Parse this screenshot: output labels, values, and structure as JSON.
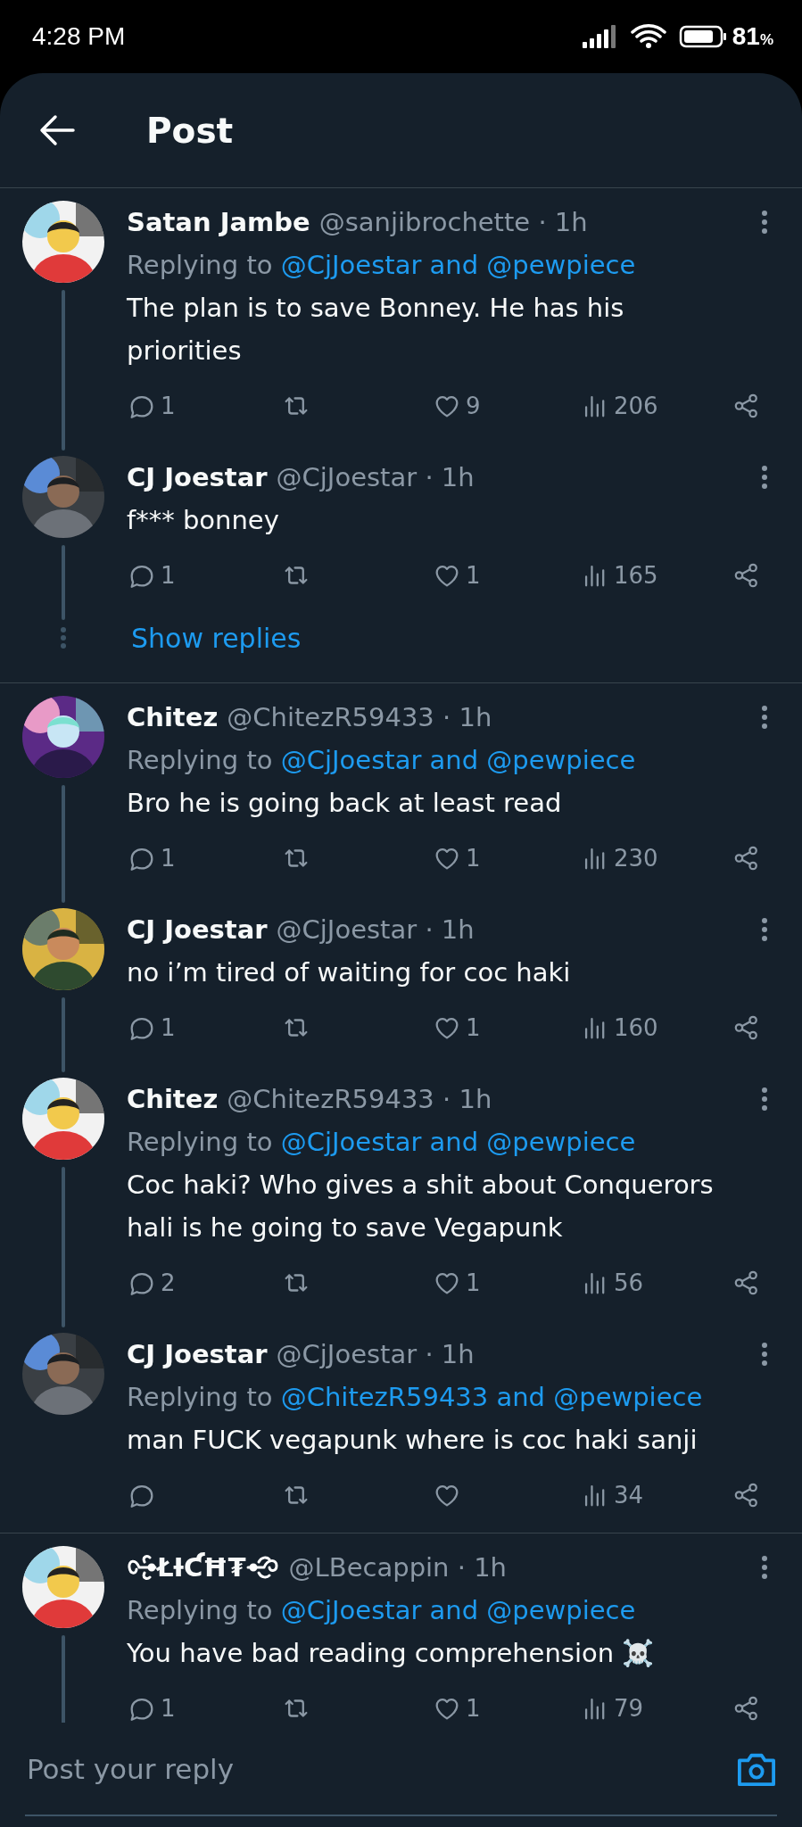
{
  "status_bar": {
    "time": "4:28 PM",
    "battery": "81",
    "battery_unit": "%"
  },
  "header": {
    "title": "Post"
  },
  "threads": [
    {
      "tweets": [
        {
          "name": "Satan Jambe",
          "handle": "@sanjibrochette",
          "time": "· 1h",
          "replying_prefix": "Replying to",
          "replying_to": "@CjJoestar and @pewpiece",
          "text": [
            "The plan is to save Bonney. He has his",
            "priorities"
          ],
          "replies": "1",
          "likes": "9",
          "views": "206",
          "connected": true
        },
        {
          "name": "CJ Joestar",
          "handle": "@CjJoestar",
          "time": "· 1h",
          "text": [
            "f*** bonney"
          ],
          "replies": "1",
          "likes": "1",
          "views": "165",
          "connected": true
        }
      ],
      "show_replies": "Show replies"
    },
    {
      "tweets": [
        {
          "name": "Chitez",
          "handle": "@ChitezR59433",
          "time": "· 1h",
          "replying_prefix": "Replying to",
          "replying_to": "@CjJoestar and @pewpiece",
          "text": [
            "Bro he is going back at least read"
          ],
          "replies": "1",
          "likes": "1",
          "views": "230",
          "connected": true
        },
        {
          "name": "CJ Joestar",
          "handle": "@CjJoestar",
          "time": "· 1h",
          "text": [
            "no i’m tired of waiting for coc haki"
          ],
          "replies": "1",
          "likes": "1",
          "views": "160",
          "connected": true
        },
        {
          "name": "Chitez",
          "handle": "@ChitezR59433",
          "time": "· 1h",
          "replying_prefix": "Replying to",
          "replying_to": "@CjJoestar and @pewpiece",
          "text": [
            "Coc haki? Who gives a shit about Conquerors",
            "hali is he going  to save Vegapunk"
          ],
          "replies": "2",
          "likes": "1",
          "views": "56",
          "connected": true
        },
        {
          "name": "CJ Joestar",
          "handle": "@CjJoestar",
          "time": "· 1h",
          "replying_prefix": "Replying to",
          "replying_to": "@ChitezR59433 and @pewpiece",
          "text": [
            "man FUCK vegapunk where is coc haki sanji"
          ],
          "views": "34",
          "connected": false
        }
      ]
    },
    {
      "tweets": [
        {
          "name": "ŁƗƇĦ₮",
          "ornate": true,
          "handle": "@LBecappin",
          "time": "· 1h",
          "replying_prefix": "Replying to",
          "replying_to": "@CjJoestar and @pewpiece",
          "text": [
            "You have bad reading comprehension ☠️"
          ],
          "replies": "1",
          "likes": "1",
          "views": "79",
          "connected": true
        }
      ]
    }
  ],
  "reply_bar": {
    "placeholder": "Post your reply"
  }
}
